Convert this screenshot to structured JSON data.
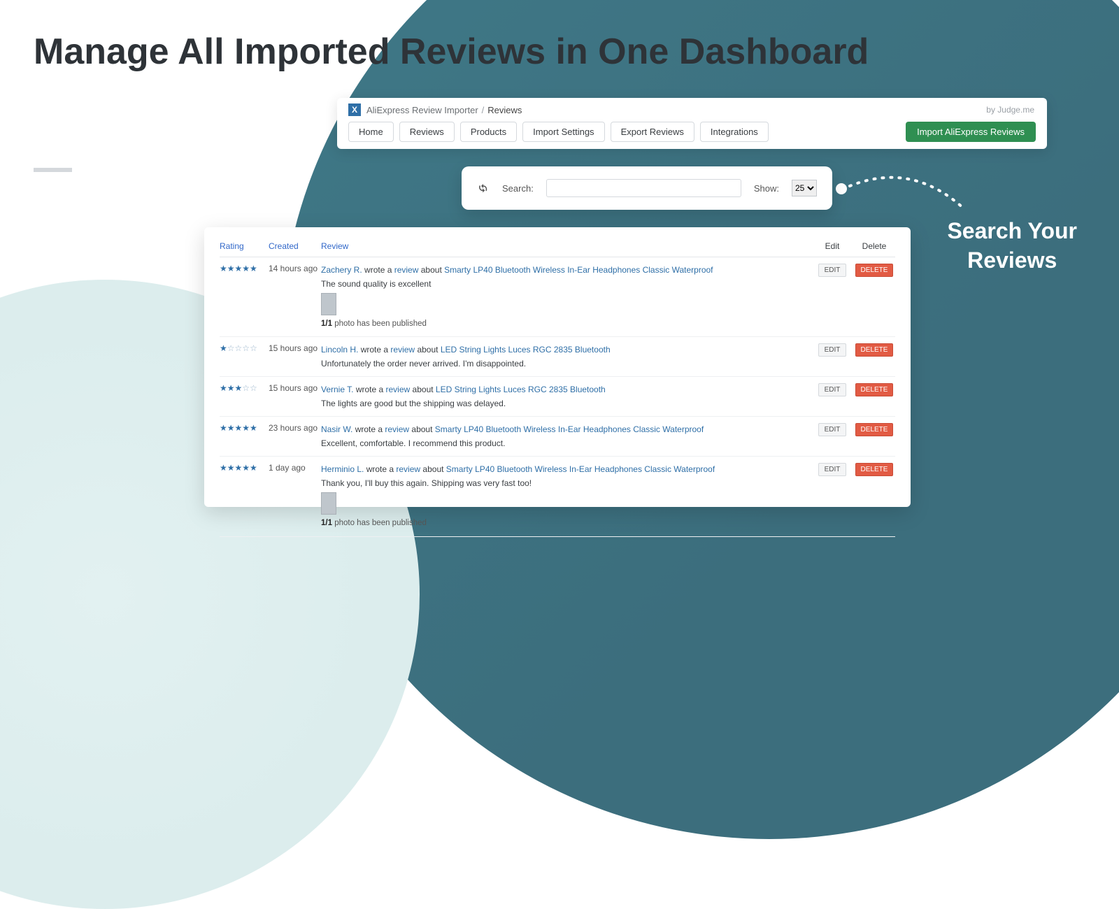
{
  "headline": "Manage All Imported Reviews in One Dashboard",
  "callout": "Search Your\nReviews",
  "topbar": {
    "app_name": "AliExpress Review Importer",
    "crumb_current": "Reviews",
    "byline": "by Judge.me",
    "nav": [
      "Home",
      "Reviews",
      "Products",
      "Import Settings",
      "Export Reviews",
      "Integrations"
    ],
    "import_btn": "Import AliExpress Reviews"
  },
  "search": {
    "search_label": "Search:",
    "show_label": "Show:",
    "show_value": "25"
  },
  "table": {
    "headers": {
      "rating": "Rating",
      "created": "Created",
      "review": "Review",
      "edit": "Edit",
      "delete": "Delete"
    },
    "edit_btn": "EDIT",
    "delete_btn": "DELETE",
    "wrote_a": "wrote a",
    "review_word": "review",
    "about": "about",
    "photo_line_prefix": "1/1",
    "photo_line_suffix": " photo has been published"
  },
  "reviews": [
    {
      "stars": 5,
      "created": "14 hours ago",
      "author": "Zachery R.",
      "product": "Smarty LP40 Bluetooth Wireless In-Ear Headphones Classic Waterproof",
      "text": "The sound quality is excellent",
      "has_photo": true
    },
    {
      "stars": 1,
      "created": "15 hours ago",
      "author": "Lincoln H.",
      "product": "LED String Lights Luces RGC 2835 Bluetooth",
      "text": "Unfortunately the order never arrived. I'm disappointed.",
      "has_photo": false
    },
    {
      "stars": 3,
      "created": "15 hours ago",
      "author": "Vernie T.",
      "product": "LED String Lights Luces RGC 2835 Bluetooth",
      "text": "The lights are good but the shipping was delayed.",
      "has_photo": false
    },
    {
      "stars": 5,
      "created": "23 hours ago",
      "author": "Nasir W.",
      "product": "Smarty LP40 Bluetooth Wireless In-Ear Headphones Classic Waterproof",
      "text": "Excellent, comfortable. I recommend this product.",
      "has_photo": false
    },
    {
      "stars": 5,
      "created": "1 day ago",
      "author": "Herminio L.",
      "product": "Smarty LP40 Bluetooth Wireless In-Ear Headphones Classic Waterproof",
      "text": "Thank you, I'll buy this again. Shipping was very fast too!",
      "has_photo": true
    }
  ]
}
